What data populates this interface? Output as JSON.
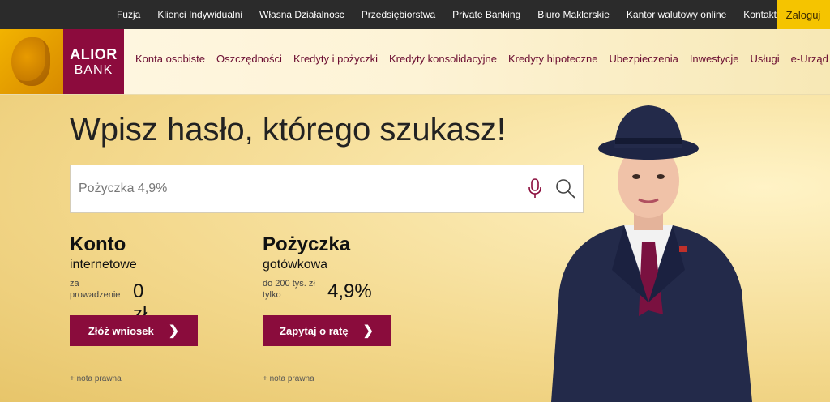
{
  "topnav": {
    "items": [
      "Fuzja",
      "Klienci Indywidualni",
      "Własna Działalnosc",
      "Przedsiębiorstwa",
      "Private Banking",
      "Biuro Maklerskie",
      "Kantor walutowy online",
      "Kontakt"
    ],
    "login": "Zaloguj"
  },
  "logo": {
    "line1": "ALIOR",
    "line2": "BANK"
  },
  "mainnav": {
    "items": [
      "Konta osobiste",
      "Oszczędności",
      "Kredyty i pożyczki",
      "Kredyty konsolidacyjne",
      "Kredyty hipoteczne",
      "Ubezpieczenia",
      "Inwestycje",
      "Usługi",
      "e-Urząd"
    ]
  },
  "hero": {
    "heading": "Wpisz hasło, którego szukasz!",
    "search_value": "Pożyczka 4,9%"
  },
  "promo1": {
    "title": "Konto",
    "subtitle": "internetowe",
    "small1": "za",
    "small2": "prowadzenie",
    "value": "0 zł",
    "button": "Złóż wniosek",
    "note": "+ nota prawna"
  },
  "promo2": {
    "title": "Pożyczka",
    "subtitle": "gotówkowa",
    "small1": "do 200 tys. zł",
    "small2": "tylko",
    "value": "4,9%",
    "button": "Zapytaj o ratę",
    "note": "+ nota prawna"
  },
  "colors": {
    "brand": "#8a0c3c",
    "accent": "#f5c400",
    "topbar": "#2b2b2b"
  },
  "icons": [
    "microphone-icon",
    "search-icon",
    "chevron-right-icon"
  ]
}
